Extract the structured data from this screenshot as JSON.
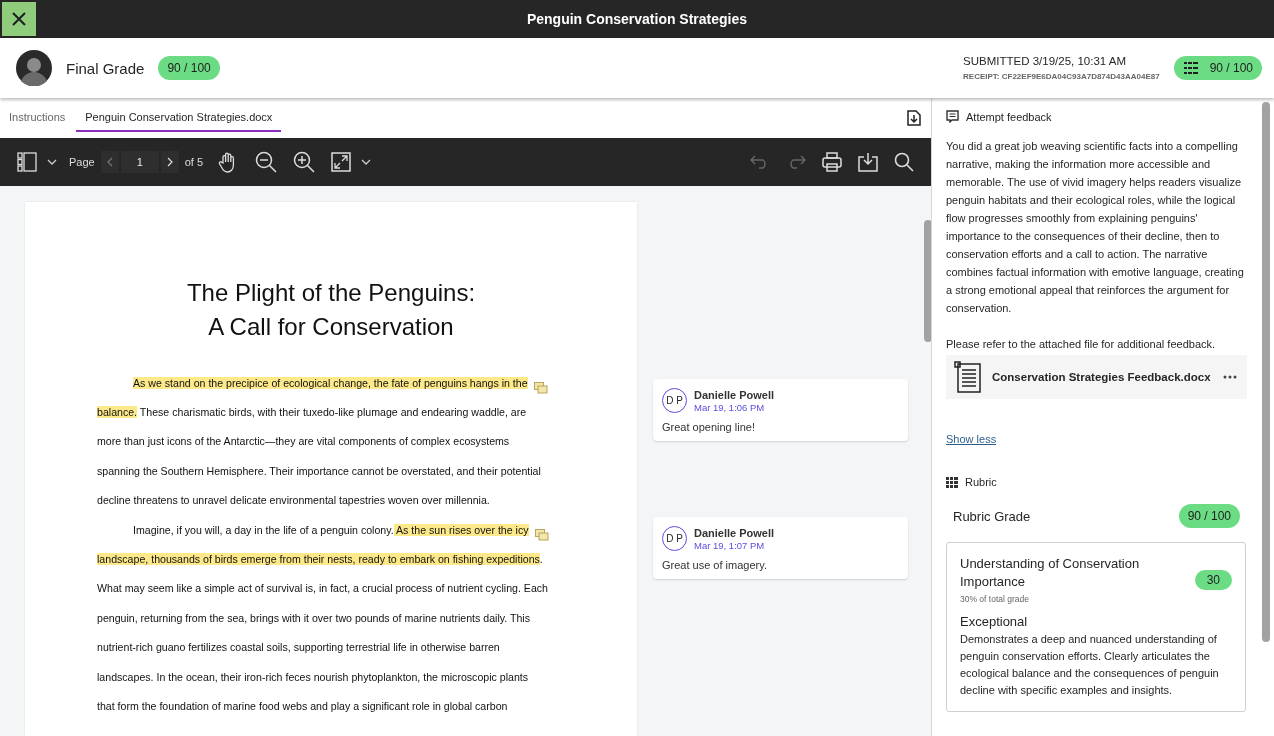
{
  "window": {
    "title": "Penguin Conservation Strategies"
  },
  "header": {
    "label": "Final Grade",
    "grade": "90 / 100",
    "submitted": "SUBMITTED 3/19/25, 10:31 AM",
    "receipt": "RECEIPT: CF22EF9E6DA04C93A7D874D43AA04E87",
    "rubric_grade": "90 / 100"
  },
  "tabs": [
    {
      "label": "Instructions",
      "selected": false
    },
    {
      "label": "Penguin Conservation Strategies.docx",
      "selected": true
    }
  ],
  "toolbar": {
    "page_label": "Page",
    "page": "1",
    "page_count": "of 5",
    "undo_disabled": true,
    "redo_disabled": true
  },
  "document": {
    "title_lines": [
      "The Plight of the Penguins:",
      "A Call for Conservation"
    ],
    "lines": [
      {
        "indent": true,
        "comment_marker": true,
        "segments": [
          {
            "text": "As we stand on the precipice of ecological change, the fate of penguins hangs in the",
            "highlighted": true
          }
        ]
      },
      {
        "indent": false,
        "comment_marker": false,
        "segments": [
          {
            "text": "balance.",
            "highlighted": true
          },
          {
            "text": " These charismatic birds, with their tuxedo-like plumage and endearing waddle, are",
            "highlighted": false
          }
        ]
      },
      {
        "indent": false,
        "comment_marker": false,
        "segments": [
          {
            "text": "more than just icons of the Antarctic—they are vital components of complex ecosystems",
            "highlighted": false
          }
        ]
      },
      {
        "indent": false,
        "comment_marker": false,
        "segments": [
          {
            "text": "spanning the Southern Hemisphere. Their importance cannot be overstated, and their potential",
            "highlighted": false
          }
        ]
      },
      {
        "indent": false,
        "comment_marker": false,
        "segments": [
          {
            "text": "decline threatens to unravel delicate environmental tapestries woven over millennia.",
            "highlighted": false
          }
        ]
      },
      {
        "indent": true,
        "comment_marker": true,
        "segments": [
          {
            "text": "Imagine, if you will, a day in the life of a penguin colony.",
            "highlighted": false
          },
          {
            "text": " As the sun rises over the icy",
            "highlighted": true
          }
        ]
      },
      {
        "indent": false,
        "comment_marker": false,
        "segments": [
          {
            "text": "landscape, thousands of birds emerge from their nests, ready to embark on fishing expeditions",
            "highlighted": true
          },
          {
            "text": ".",
            "highlighted": false
          }
        ]
      },
      {
        "indent": false,
        "comment_marker": false,
        "segments": [
          {
            "text": "What may seem like a simple act of survival is, in fact, a crucial process of nutrient cycling. Each",
            "highlighted": false
          }
        ]
      },
      {
        "indent": false,
        "comment_marker": false,
        "segments": [
          {
            "text": "penguin, returning from the sea, brings with it over two pounds of marine nutrients daily. This",
            "highlighted": false
          }
        ]
      },
      {
        "indent": false,
        "comment_marker": false,
        "segments": [
          {
            "text": "nutrient-rich guano fertilizes coastal soils, supporting terrestrial life in otherwise barren",
            "highlighted": false
          }
        ]
      },
      {
        "indent": false,
        "comment_marker": false,
        "segments": [
          {
            "text": "landscapes. In the ocean, their iron-rich feces nourish phytoplankton, the microscopic plants",
            "highlighted": false
          }
        ]
      },
      {
        "indent": false,
        "comment_marker": false,
        "segments": [
          {
            "text": "that form the foundation of marine food webs and play a significant role in global carbon",
            "highlighted": false
          }
        ]
      }
    ]
  },
  "comments": [
    {
      "initials": "D P",
      "author": "Danielle Powell",
      "time": "Mar 19, 1:06 PM",
      "text": "Great opening line!"
    },
    {
      "initials": "D P",
      "author": "Danielle Powell",
      "time": "Mar 19, 1:07 PM",
      "text": "Great use of imagery."
    }
  ],
  "feedback": {
    "title": "Attempt feedback",
    "body": "You did a great job weaving scientific facts into a compelling narrative, making the information more accessible and memorable. The use of vivid imagery helps readers visualize penguin habitats and their ecological roles, while the logical flow progresses smoothly from explaining penguins' importance to the consequences of their decline, then to conservation efforts and a call to action. The narrative combines factual information with emotive language, creating a strong emotional appeal that reinforces the argument for conservation.",
    "note": "Please refer to the attached file for additional feedback.",
    "attachment": "Conservation Strategies Feedback.docx",
    "toggle": "Show less"
  },
  "rubric": {
    "title": "Rubric",
    "grade_label": "Rubric Grade",
    "grade": "90 / 100",
    "criteria": [
      {
        "name": "Understanding of Conservation Importance",
        "weight": "30% of total grade",
        "points": "30",
        "level": "Exceptional",
        "description": "Demonstrates a deep and nuanced understanding of penguin conservation efforts. Clearly articulates the ecological balance and the consequences of penguin decline with specific examples and insights."
      }
    ]
  }
}
